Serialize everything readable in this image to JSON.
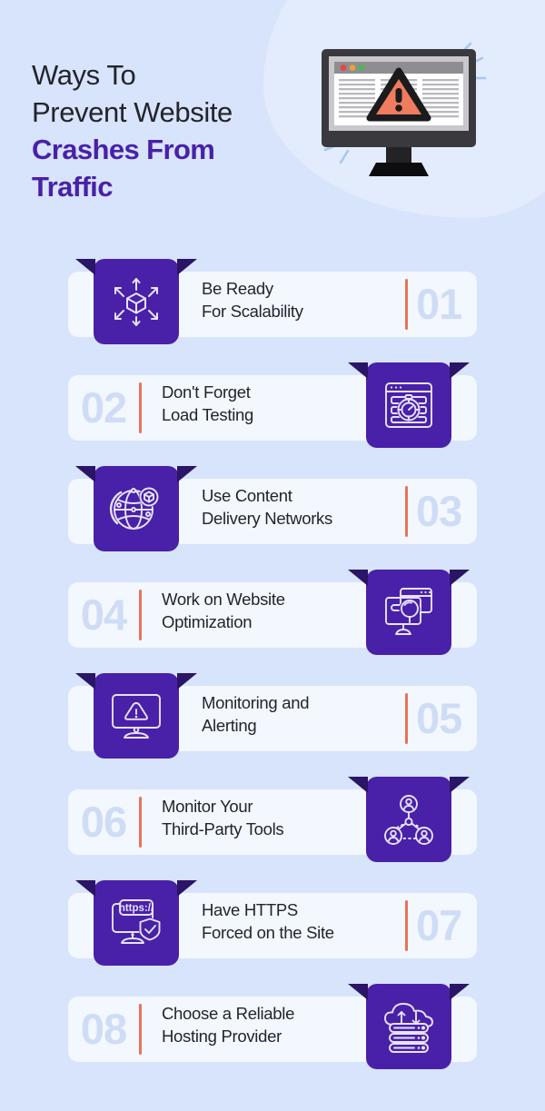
{
  "colors": {
    "page_bg": "#d7e4fb",
    "card_bg": "#f3f7fe",
    "badge_purple": "#4921a8",
    "badge_wing": "#2b1566",
    "accent_coral": "#e8725a",
    "number_blue": "#cfdcf6",
    "title_dark": "#22252c",
    "title_purple": "#4921a8",
    "warning_triangle": "#ef7c5e",
    "monitor_body": "#3a3a3e"
  },
  "header": {
    "title_lines": [
      {
        "text": "Ways To",
        "style": "regular"
      },
      {
        "text": "Prevent Website",
        "style": "regular"
      },
      {
        "text": "Crashes From",
        "style": "accent"
      },
      {
        "text": "Traffic",
        "style": "accent"
      }
    ],
    "illustration": "monitor-warning-illustration",
    "browser_dots": [
      "#e8473f",
      "#f0a132",
      "#4cb84c"
    ]
  },
  "rows": [
    {
      "number": "01",
      "title_line1": "Be Ready",
      "title_line2": "For Scalability",
      "icon": "scalability-cube-arrows-icon",
      "side": "left"
    },
    {
      "number": "02",
      "title_line1": "Don't Forget",
      "title_line2": "Load Testing",
      "icon": "load-testing-stopwatch-icon",
      "side": "right"
    },
    {
      "number": "03",
      "title_line1": "Use Content",
      "title_line2": "Delivery Networks",
      "icon": "cdn-globe-icon",
      "side": "left"
    },
    {
      "number": "04",
      "title_line1": "Work on Website",
      "title_line2": "Optimization",
      "icon": "website-optimization-magnifier-icon",
      "side": "right"
    },
    {
      "number": "05",
      "title_line1": "Monitoring and",
      "title_line2": "Alerting",
      "icon": "monitoring-alert-monitor-icon",
      "side": "left"
    },
    {
      "number": "06",
      "title_line1": "Monitor Your",
      "title_line2": "Third-Party Tools",
      "icon": "third-party-network-users-icon",
      "side": "right"
    },
    {
      "number": "07",
      "title_line1": "Have HTTPS",
      "title_line2": "Forced on the Site",
      "icon": "https-shield-icon",
      "side": "left"
    },
    {
      "number": "08",
      "title_line1": "Choose a Reliable",
      "title_line2": "Hosting Provider",
      "icon": "cloud-hosting-server-icon",
      "side": "right"
    }
  ]
}
